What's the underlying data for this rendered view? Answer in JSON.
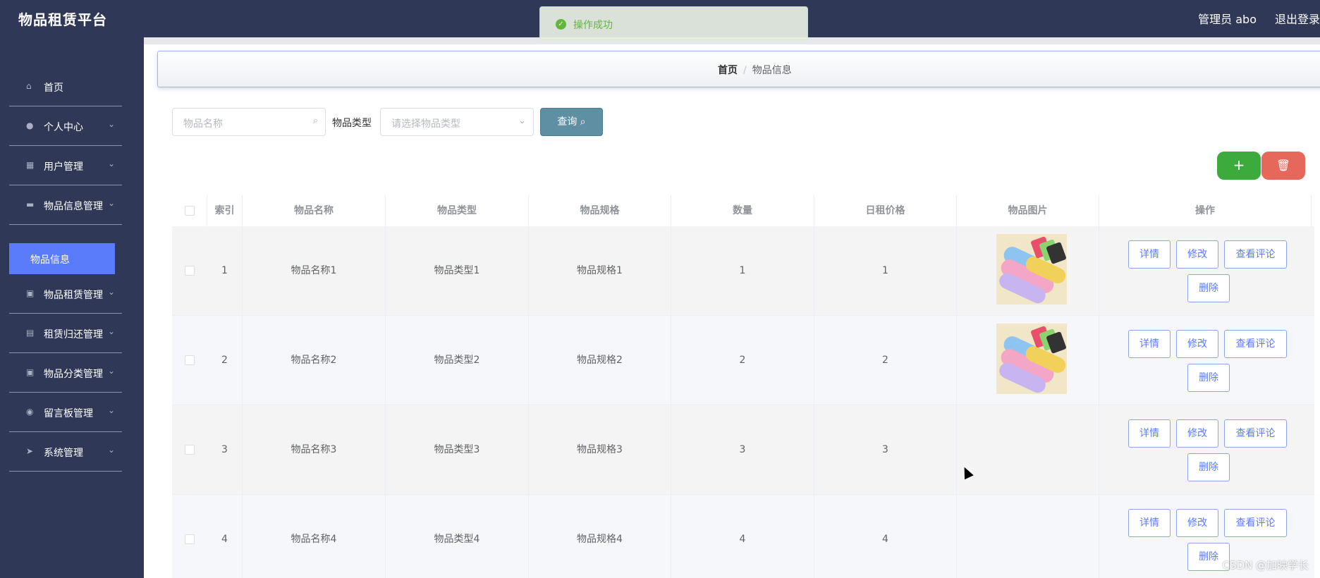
{
  "header": {
    "title": "物品租赁平台",
    "user": "管理员 abo",
    "logout": "退出登录"
  },
  "toast": {
    "message": "操作成功"
  },
  "sidebar": {
    "items": [
      {
        "label": "首页",
        "icon": "home-icon",
        "arrow": ""
      },
      {
        "label": "个人中心",
        "icon": "user-icon",
        "arrow": "⌄"
      },
      {
        "label": "用户管理",
        "icon": "grid-icon",
        "arrow": "⌄"
      },
      {
        "label": "物品信息管理",
        "icon": "goods-icon",
        "arrow": "⌄"
      },
      {
        "label": "物品租赁管理",
        "icon": "clipboard-icon",
        "arrow": "⌄"
      },
      {
        "label": "租赁归还管理",
        "icon": "briefcase-icon",
        "arrow": "⌄"
      },
      {
        "label": "物品分类管理",
        "icon": "clipboard-icon",
        "arrow": "⌄"
      },
      {
        "label": "留言板管理",
        "icon": "location-icon",
        "arrow": "⌄"
      },
      {
        "label": "系统管理",
        "icon": "send-icon",
        "arrow": "⌄"
      }
    ],
    "active_sub": "物品信息"
  },
  "breadcrumb": {
    "home": "首页",
    "separator": "/",
    "current": "物品信息"
  },
  "search": {
    "name_placeholder": "物品名称",
    "type_label": "物品类型",
    "type_placeholder": "请选择物品类型",
    "query_button": "查询"
  },
  "toolbar": {
    "add": "+",
    "delete": "🗑"
  },
  "table": {
    "headers": [
      "索引",
      "物品名称",
      "物品类型",
      "物品规格",
      "数量",
      "日租价格",
      "物品图片",
      "操作"
    ],
    "rows": [
      {
        "index": "1",
        "name": "物品名称1",
        "type": "物品类型1",
        "spec": "物品规格1",
        "qty": "1",
        "price": "1"
      },
      {
        "index": "2",
        "name": "物品名称2",
        "type": "物品类型2",
        "spec": "物品规格2",
        "qty": "2",
        "price": "2"
      },
      {
        "index": "3",
        "name": "物品名称3",
        "type": "物品类型3",
        "spec": "物品规格3",
        "qty": "3",
        "price": "3"
      },
      {
        "index": "4",
        "name": "物品名称4",
        "type": "物品类型4",
        "spec": "物品规格4",
        "qty": "4",
        "price": "4"
      }
    ],
    "actions": {
      "detail": "详情",
      "edit": "修改",
      "comments": "查看评论",
      "delete": "删除"
    }
  },
  "watermark": "CSDN @加映学长"
}
